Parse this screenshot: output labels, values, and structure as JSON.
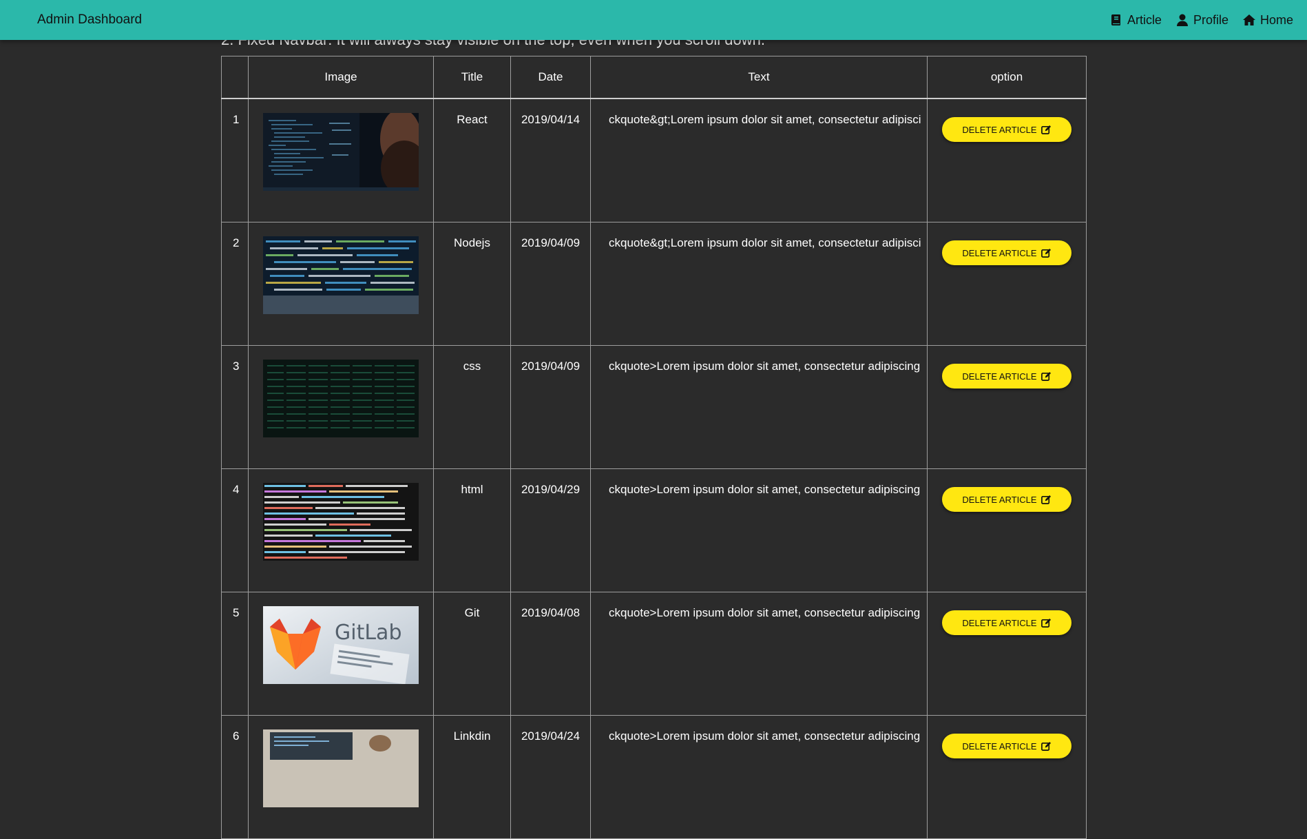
{
  "navbar": {
    "brand": "Admin Dashboard",
    "links": [
      {
        "label": "Article",
        "icon": "book-icon"
      },
      {
        "label": "Profile",
        "icon": "user-icon"
      },
      {
        "label": "Home",
        "icon": "home-icon"
      }
    ],
    "bg_color": "#2bb8aa"
  },
  "intro_text": "2. Fixed Navbar: It will always stay visible on the top, even when you scroll down.",
  "table": {
    "headers": [
      "",
      "Image",
      "Title",
      "Date",
      "Text",
      "option"
    ],
    "rows": [
      {
        "index": "1",
        "image": "code-screen-person-image",
        "title": "React",
        "date": "2019/04/14",
        "text": "ckquote&gt;Lorem ipsum dolor sit amet, consectetur adipisci",
        "option": "DELETE ARTICLE"
      },
      {
        "index": "2",
        "image": "code-blur-image",
        "title": "Nodejs",
        "date": "2019/04/09",
        "text": "ckquote&gt;Lorem ipsum dolor sit amet, consectetur adipisci",
        "option": "DELETE ARTICLE"
      },
      {
        "index": "3",
        "image": "matrix-dark-image",
        "title": "css",
        "date": "2019/04/09",
        "text": "ckquote>Lorem ipsum dolor sit amet, consectetur adipiscing",
        "option": "DELETE ARTICLE"
      },
      {
        "index": "4",
        "image": "js-source-code-image",
        "title": "html",
        "date": "2019/04/29",
        "text": "ckquote>Lorem ipsum dolor sit amet, consectetur adipiscing",
        "option": "DELETE ARTICLE"
      },
      {
        "index": "5",
        "image": "gitlab-logo-image",
        "title": "Git",
        "date": "2019/04/08",
        "text": "ckquote>Lorem ipsum dolor sit amet, consectetur adipiscing",
        "option": "DELETE ARTICLE"
      },
      {
        "index": "6",
        "image": "laptop-desk-image",
        "title": "Linkdin",
        "date": "2019/04/24",
        "text": "ckquote>Lorem ipsum dolor sit amet, consectetur adipiscing",
        "option": "DELETE ARTICLE"
      }
    ]
  },
  "gitlab_logo_text": "GitLab",
  "colors": {
    "button": "#ffe711",
    "background": "#2b2b2b"
  }
}
